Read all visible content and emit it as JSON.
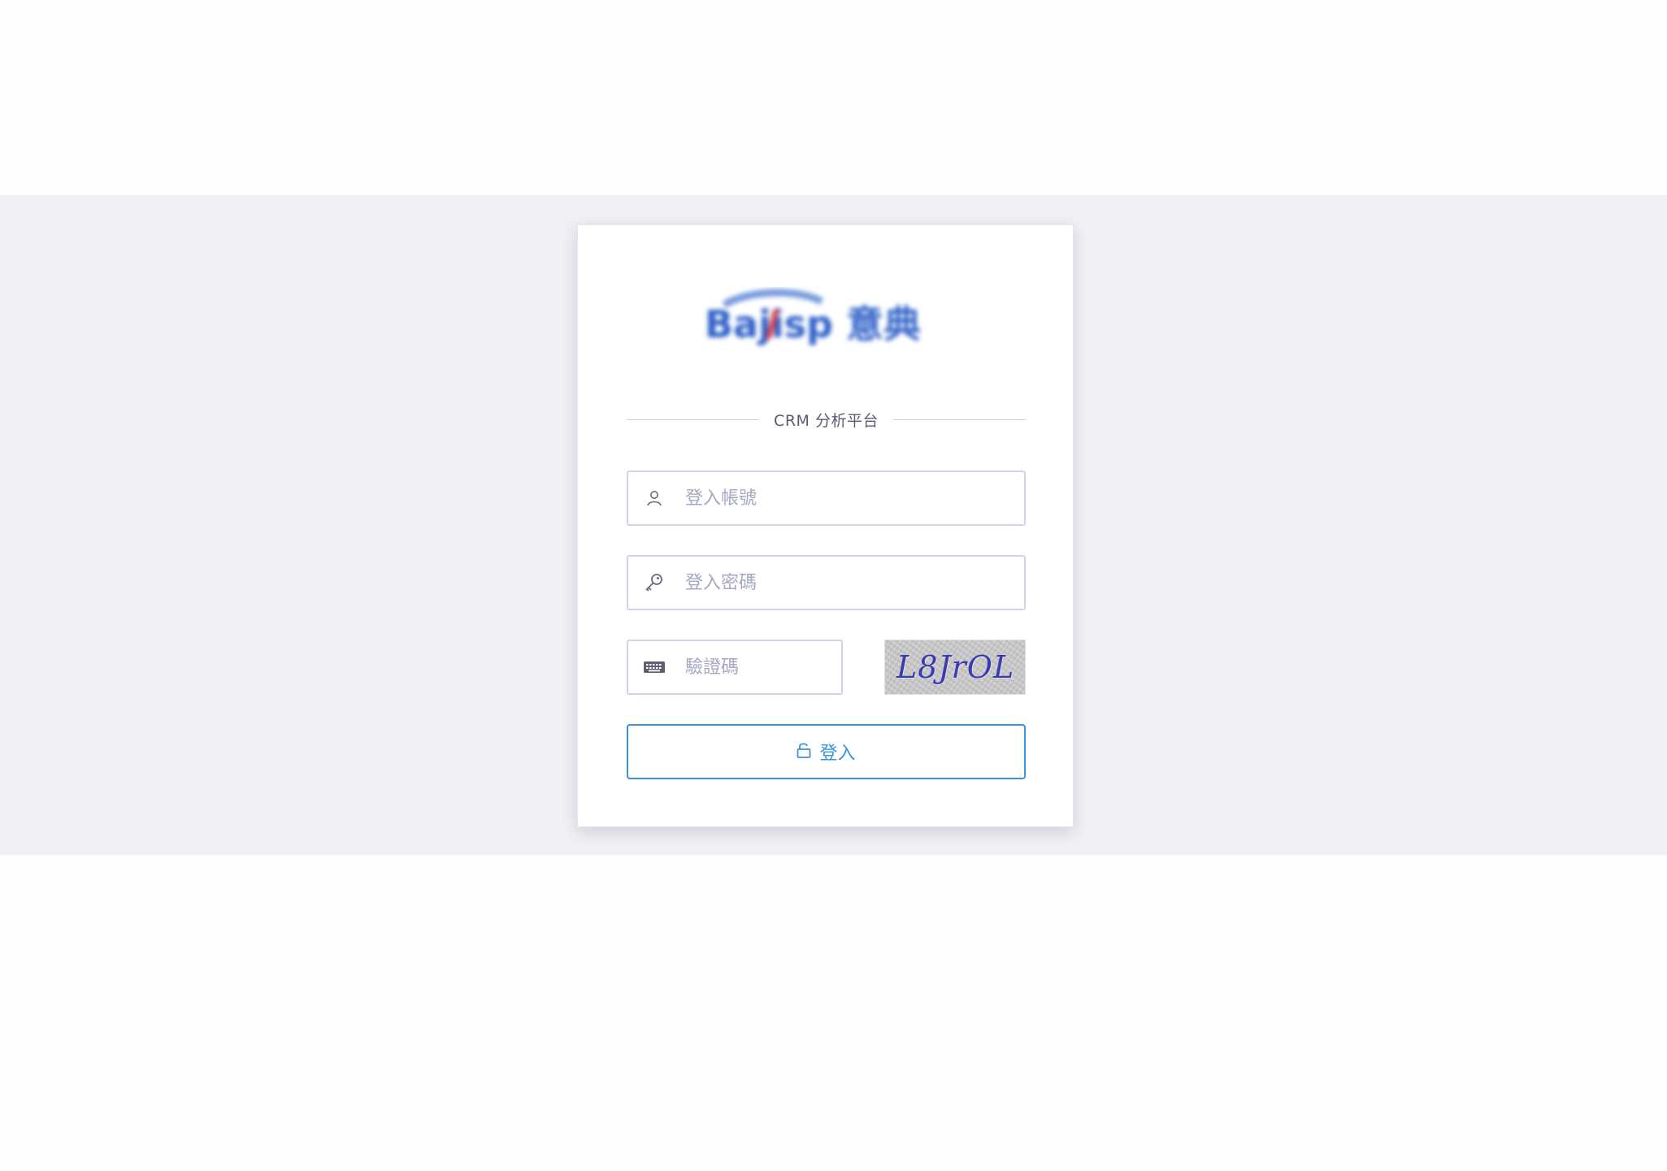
{
  "brand": {
    "logo_text": "Bajisp 意典"
  },
  "section_title": "CRM 分析平台",
  "form": {
    "account_placeholder": "登入帳號",
    "password_placeholder": "登入密碼",
    "captcha_placeholder": "驗證碼",
    "captcha_text": "L8JrOL",
    "login_label": "登入"
  },
  "colors": {
    "accent": "#3a93dc",
    "input_border": "#d2d2ea",
    "placeholder": "#a6a7c4",
    "band": "#f1f0f4"
  },
  "icons": {
    "account": "user-icon",
    "password": "key-icon",
    "captcha": "keyboard-icon",
    "login": "unlock-icon"
  }
}
